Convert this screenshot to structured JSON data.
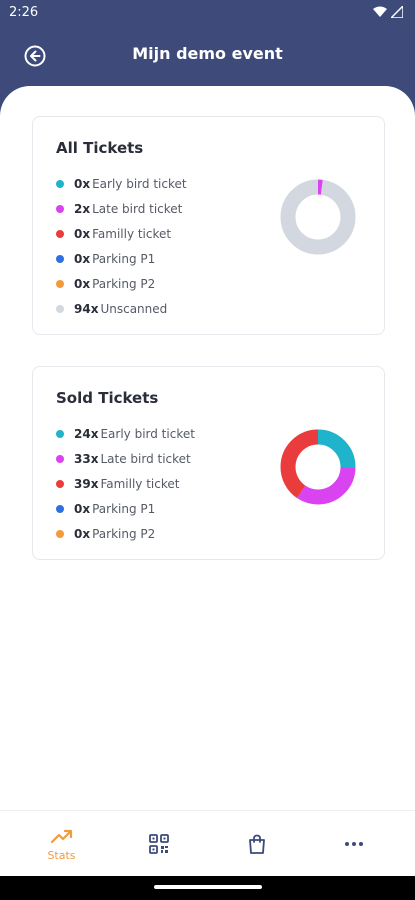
{
  "status_bar": {
    "time": "2:26"
  },
  "app_bar": {
    "title": "Mijn demo event"
  },
  "all_tickets": {
    "title": "All Tickets",
    "items": [
      {
        "count": "0x",
        "label": "Early bird ticket",
        "color": "#1fb4cc",
        "value": 0
      },
      {
        "count": "2x",
        "label": "Late bird ticket",
        "color": "#d944f0",
        "value": 2
      },
      {
        "count": "0x",
        "label": "Familly ticket",
        "color": "#ea3c3c",
        "value": 0
      },
      {
        "count": "0x",
        "label": "Parking P1",
        "color": "#2f6fe0",
        "value": 0
      },
      {
        "count": "0x",
        "label": "Parking P2",
        "color": "#f39a3c",
        "value": 0
      },
      {
        "count": "94x",
        "label": "Unscanned",
        "color": "#d3d7df",
        "value": 94
      }
    ]
  },
  "sold_tickets": {
    "title": "Sold Tickets",
    "items": [
      {
        "count": "24x",
        "label": "Early bird ticket",
        "color": "#1fb4cc",
        "value": 24
      },
      {
        "count": "33x",
        "label": "Late bird ticket",
        "color": "#d944f0",
        "value": 33
      },
      {
        "count": "39x",
        "label": "Familly ticket",
        "color": "#ea3c3c",
        "value": 39
      },
      {
        "count": "0x",
        "label": "Parking P1",
        "color": "#2f6fe0",
        "value": 0
      },
      {
        "count": "0x",
        "label": "Parking P2",
        "color": "#f39a3c",
        "value": 0
      }
    ]
  },
  "bottom_nav": {
    "items": [
      {
        "label": "Stats",
        "icon": "trending-up-icon",
        "active": true
      },
      {
        "label": "",
        "icon": "qr-code-icon",
        "active": false
      },
      {
        "label": "",
        "icon": "shopping-bag-icon",
        "active": false
      },
      {
        "label": "",
        "icon": "more-icon",
        "active": false
      }
    ]
  },
  "colors": {
    "primary": "#3d4a7a",
    "accent": "#f39a3c",
    "nav_icon": "#3d4a7a"
  }
}
